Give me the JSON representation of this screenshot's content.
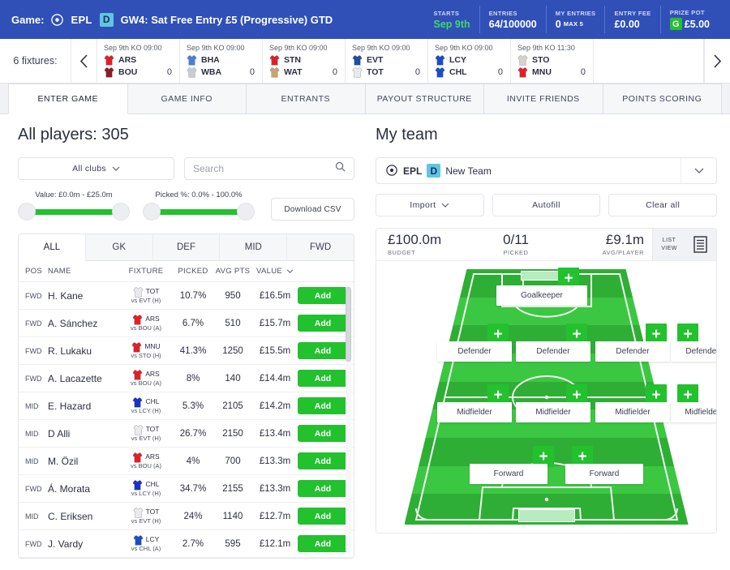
{
  "header": {
    "game_label": "Game:",
    "ball_icon": "ball-icon",
    "league": "EPL",
    "division_badge": "D",
    "title": "GW4: Sat  Free Entry £5 (Progressive) GTD",
    "stats": [
      {
        "label": "STARTS",
        "value": "Sep 9th",
        "accent": "green"
      },
      {
        "label": "ENTRIES",
        "value": "64/100000"
      },
      {
        "label": "MY ENTRIES",
        "value": "0",
        "sub": "MAX 5"
      },
      {
        "label": "ENTRY FEE",
        "value": "£0.00"
      },
      {
        "label": "PRIZE POT",
        "value": "£5.00",
        "badge": "G"
      }
    ]
  },
  "fixtures": {
    "count_label": "6 fixtures:",
    "prev_icon": "chevron-left-icon",
    "next_icon": "chevron-right-icon",
    "items": [
      {
        "ko": "Sep 9th KO 09:00",
        "home": "ARS",
        "away": "BOU",
        "score": "0",
        "home_color": "#e21f26",
        "away_color": "#8e1b24"
      },
      {
        "ko": "Sep 9th KO 09:00",
        "home": "BHA",
        "away": "WBA",
        "score": "0",
        "home_color": "#4b7fd6",
        "away_color": "#c9ccd4"
      },
      {
        "ko": "Sep 9th KO 09:00",
        "home": "STN",
        "away": "WAT",
        "score": "0",
        "home_color": "#e21f26",
        "away_color": "#c9a46a"
      },
      {
        "ko": "Sep 9th KO 09:00",
        "home": "EVT",
        "away": "TOT",
        "score": "0",
        "home_color": "#1f4ea1",
        "away_color": "#e9eaee"
      },
      {
        "ko": "Sep 9th KO 09:00",
        "home": "LCY",
        "away": "CHL",
        "score": "0",
        "home_color": "#1b4ec4",
        "away_color": "#1b4ec4"
      },
      {
        "ko": "Sep 9th KO 11:30",
        "home": "STO",
        "away": "MNU",
        "score": "0",
        "home_color": "#d8d2cc",
        "away_color": "#e21f26"
      }
    ]
  },
  "tabs": [
    {
      "label": "ENTER GAME",
      "active": true
    },
    {
      "label": "GAME INFO",
      "active": false
    },
    {
      "label": "ENTRANTS",
      "active": false
    },
    {
      "label": "PAYOUT STRUCTURE",
      "active": false
    },
    {
      "label": "INVITE FRIENDS",
      "active": false
    },
    {
      "label": "POINTS SCORING",
      "active": false
    }
  ],
  "players_panel": {
    "title": "All players: 305",
    "club_filter": "All clubs",
    "search_placeholder": "Search",
    "search_value": "",
    "value_slider": {
      "label": "Value:  £0.0m - £25.0m"
    },
    "picked_slider": {
      "label": "Picked %:  0.0% - 100.0%"
    },
    "download_csv": "Download CSV",
    "position_tabs": [
      {
        "label": "ALL",
        "active": true
      },
      {
        "label": "GK",
        "active": false
      },
      {
        "label": "DEF",
        "active": false
      },
      {
        "label": "MID",
        "active": false
      },
      {
        "label": "FWD",
        "active": false
      }
    ],
    "columns": [
      "POS",
      "NAME",
      "FIXTURE",
      "PICKED",
      "AVG PTS",
      "VALUE"
    ],
    "sort_column": "VALUE",
    "add_label": "Add",
    "rows": [
      {
        "pos": "FWD",
        "name": "H. Kane",
        "club": "TOT",
        "opp": "vs EVT (H)",
        "picked": "10.7%",
        "avg": "950",
        "value": "£16.5m",
        "color": "#e9eaee"
      },
      {
        "pos": "FWD",
        "name": "A. Sánchez",
        "club": "ARS",
        "opp": "vs BOU (A)",
        "picked": "6.7%",
        "avg": "510",
        "value": "£15.7m",
        "color": "#e21f26"
      },
      {
        "pos": "FWD",
        "name": "R. Lukaku",
        "club": "MNU",
        "opp": "vs STO (H)",
        "picked": "41.3%",
        "avg": "1250",
        "value": "£15.5m",
        "color": "#e21f26"
      },
      {
        "pos": "FWD",
        "name": "A. Lacazette",
        "club": "ARS",
        "opp": "vs BOU (A)",
        "picked": "8%",
        "avg": "140",
        "value": "£14.4m",
        "color": "#e21f26"
      },
      {
        "pos": "MID",
        "name": "E. Hazard",
        "club": "CHL",
        "opp": "vs LCY (H)",
        "picked": "5.3%",
        "avg": "2105",
        "value": "£14.2m",
        "color": "#1b32c4"
      },
      {
        "pos": "MID",
        "name": "D Alli",
        "club": "TOT",
        "opp": "vs EVT (H)",
        "picked": "26.7%",
        "avg": "2150",
        "value": "£13.4m",
        "color": "#e9eaee"
      },
      {
        "pos": "MID",
        "name": "M. Özil",
        "club": "ARS",
        "opp": "vs BOU (A)",
        "picked": "4%",
        "avg": "700",
        "value": "£13.3m",
        "color": "#e21f26"
      },
      {
        "pos": "FWD",
        "name": "Á. Morata",
        "club": "CHL",
        "opp": "vs LCY (H)",
        "picked": "34.7%",
        "avg": "2155",
        "value": "£13.3m",
        "color": "#1b32c4"
      },
      {
        "pos": "MID",
        "name": "C. Eriksen",
        "club": "TOT",
        "opp": "vs EVT (H)",
        "picked": "24%",
        "avg": "1140",
        "value": "£12.7m",
        "color": "#e9eaee"
      },
      {
        "pos": "FWD",
        "name": "J. Vardy",
        "club": "LCY",
        "opp": "vs CHL (A)",
        "picked": "2.7%",
        "avg": "595",
        "value": "£12.1m",
        "color": "#1b4ec4"
      }
    ]
  },
  "team_panel": {
    "title": "My team",
    "league": "EPL",
    "division_badge": "D",
    "team_name": "New Team",
    "buttons": [
      {
        "label": "Import",
        "caret": true
      },
      {
        "label": "Autofill",
        "caret": false
      },
      {
        "label": "Clear all",
        "caret": false
      }
    ],
    "budget": {
      "value": "£100.0m",
      "label": "BUDGET"
    },
    "picked": {
      "value": "0/11",
      "label": "PICKED"
    },
    "avg_player": {
      "value": "£9.1m",
      "label": "AVG/PLAYER"
    },
    "view_toggle": {
      "line1": "LIST",
      "line2": "VIEW",
      "icon": "list-view-icon"
    },
    "plus_label": "+",
    "formation": {
      "goalkeeper": [
        "Goalkeeper"
      ],
      "defenders": [
        "Defender",
        "Defender",
        "Defender",
        "Defender"
      ],
      "midfielders": [
        "Midfielder",
        "Midfielder",
        "Midfielder",
        "Midfielder"
      ],
      "forwards": [
        "Forward",
        "Forward"
      ]
    }
  },
  "colors": {
    "header_blue": "#3050b8",
    "accent_green": "#22c12e",
    "starts_green": "#3ed86a",
    "badge_cyan": "#5ec6e0",
    "pitch_green": "#34c13a"
  }
}
